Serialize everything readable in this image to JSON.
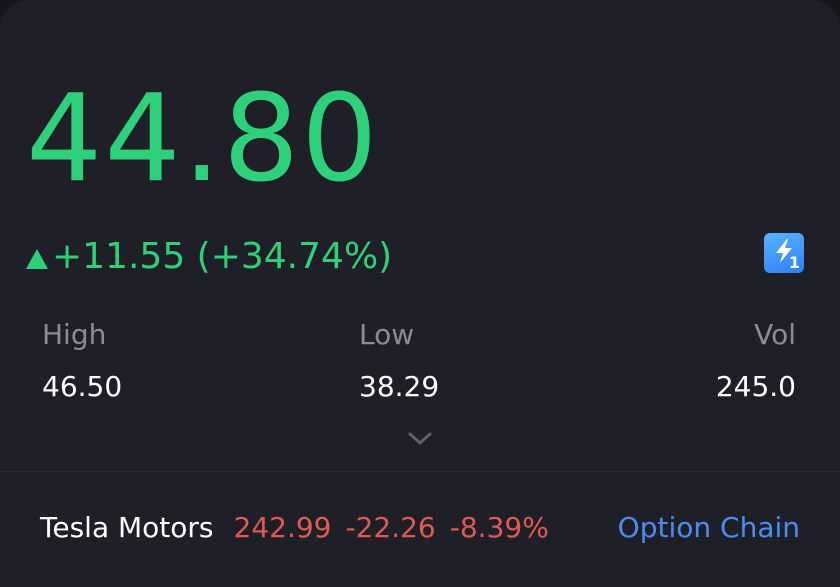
{
  "quote": {
    "price": "44.80",
    "change": "+11.55 (+34.74%)",
    "direction_icon": "triangle-up-icon",
    "color_up": "#2fd07a"
  },
  "badge": {
    "icon": "lightning-icon",
    "count": "1"
  },
  "stats": {
    "high_label": "High",
    "high_value": "46.50",
    "low_label": "Low",
    "low_value": "38.29",
    "vol_label": "Vol",
    "vol_value": "245.0"
  },
  "expand_icon": "chevron-down-icon",
  "underlying": {
    "name": "Tesla Motors",
    "price": "242.99",
    "change": "-22.26",
    "change_pct": "-8.39%",
    "color_down": "#e05a55"
  },
  "option_chain_label": "Option Chain",
  "colors": {
    "link": "#4a8df0",
    "background": "#1f1f27"
  }
}
